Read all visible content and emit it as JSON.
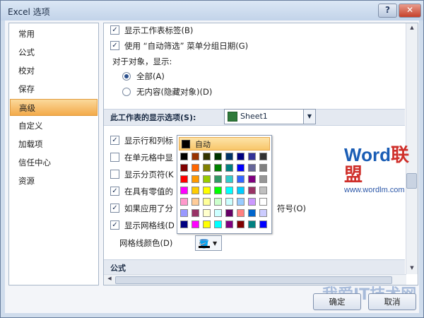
{
  "window": {
    "title": "Excel 选项",
    "help_glyph": "?",
    "close_glyph": "✕"
  },
  "sidebar": {
    "items": [
      {
        "label": "常用"
      },
      {
        "label": "公式"
      },
      {
        "label": "校对"
      },
      {
        "label": "保存"
      },
      {
        "label": "高级",
        "selected": true
      },
      {
        "label": "自定义"
      },
      {
        "label": "加载项"
      },
      {
        "label": "信任中心"
      },
      {
        "label": "资源"
      }
    ]
  },
  "content": {
    "show_sheet_tabs": {
      "label": "显示工作表标签(B)",
      "checked": true
    },
    "group_dates": {
      "label": "使用 “自动筛选” 菜单分组日期(G)",
      "checked": true
    },
    "objects_heading": "对于对象，显示:",
    "radio_all": {
      "label": "全部(A)",
      "selected": true
    },
    "radio_none": {
      "label": "无内容(隐藏对象)(D)",
      "selected": false
    },
    "sheet_section": {
      "label": "此工作表的显示选项(S):",
      "value": "Sheet1"
    },
    "opt_row_col": {
      "label": "显示行和列标",
      "checked": true
    },
    "opt_formulas": {
      "label": "在单元格中显",
      "checked": false
    },
    "opt_page_breaks": {
      "label": "显示分页符(K",
      "checked": false
    },
    "opt_zero": {
      "label": "在具有零值的",
      "checked": true
    },
    "opt_outline": {
      "label": "如果应用了分",
      "suffix": "符号(O)",
      "checked": true
    },
    "opt_gridlines": {
      "label": "显示网格线(D",
      "checked": true
    },
    "gridline_color_label": "网格线颜色(D)",
    "formula_section": "公式"
  },
  "palette": {
    "auto_label": "自动",
    "selected_index": 56,
    "colors": [
      "#000000",
      "#993300",
      "#333300",
      "#003300",
      "#003366",
      "#000080",
      "#333399",
      "#333333",
      "#800000",
      "#FF6600",
      "#808000",
      "#008000",
      "#008080",
      "#0000FF",
      "#666699",
      "#808080",
      "#FF0000",
      "#FF9900",
      "#99CC00",
      "#339966",
      "#33CCCC",
      "#3366FF",
      "#800080",
      "#969696",
      "#FF00FF",
      "#FFCC00",
      "#FFFF00",
      "#00FF00",
      "#00FFFF",
      "#00CCFF",
      "#993366",
      "#C0C0C0",
      "#FF99CC",
      "#FFCC99",
      "#FFFF99",
      "#CCFFCC",
      "#CCFFFF",
      "#99CCFF",
      "#CC99FF",
      "#FFFFFF",
      "#9999FF",
      "#993366",
      "#FFFFCC",
      "#CCFFFF",
      "#660066",
      "#FF8080",
      "#0066CC",
      "#CCCCFF",
      "#000080",
      "#FF00FF",
      "#FFFF00",
      "#00FFFF",
      "#800080",
      "#800000",
      "#008080",
      "#0000FF"
    ]
  },
  "watermark": {
    "brand_word": "Word",
    "brand_cn": "联盟",
    "url": "www.wordlm.com",
    "footer_mark": "我爱IT技术网"
  },
  "buttons": {
    "ok": "确定",
    "cancel": "取消"
  }
}
